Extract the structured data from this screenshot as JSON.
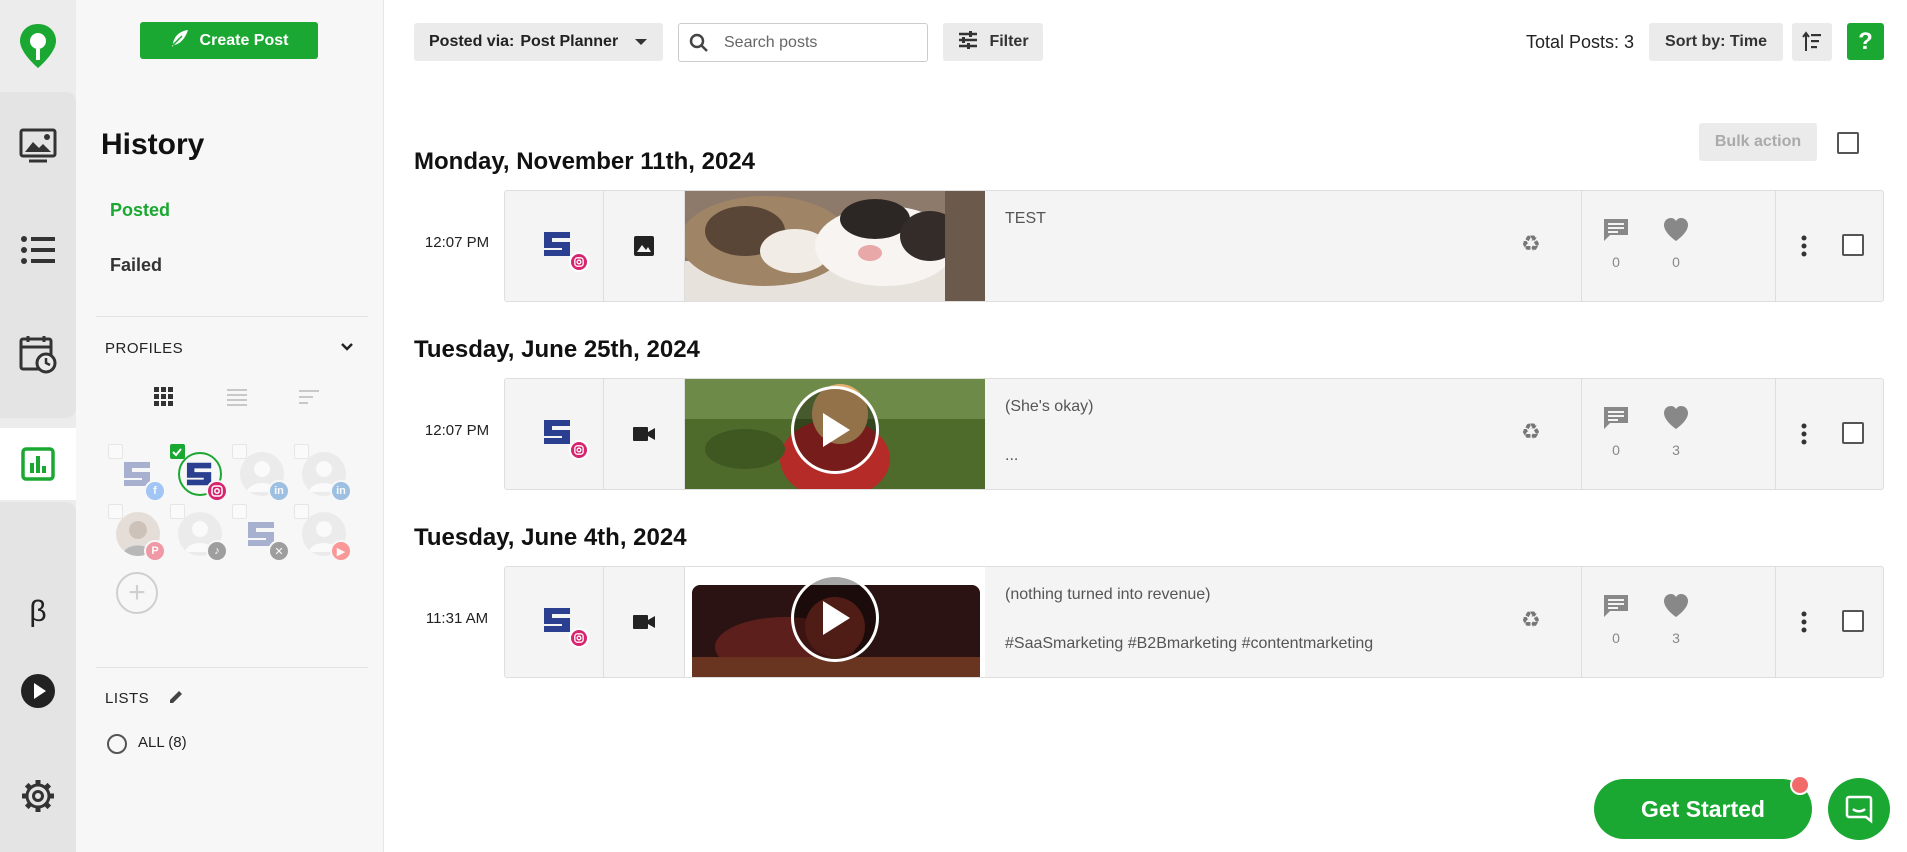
{
  "rail": {
    "items": [
      "logo-icon",
      "media-library-icon",
      "content-list-icon",
      "calendar-clock-icon",
      "analytics-icon",
      "beta-icon",
      "play-icon",
      "gear-icon"
    ],
    "beta_label": "β",
    "active": "analytics-icon"
  },
  "sidebar": {
    "create_post_label": "Create Post",
    "title": "History",
    "nav": {
      "posted": "Posted",
      "failed": "Failed"
    },
    "profiles_label": "PROFILES",
    "lists_label": "LISTS",
    "lists_all": "ALL (8)",
    "profiles": [
      {
        "network": "facebook",
        "selected": false
      },
      {
        "network": "instagram",
        "selected": true
      },
      {
        "network": "linkedin",
        "selected": false
      },
      {
        "network": "linkedin",
        "selected": false
      },
      {
        "network": "pinterest",
        "selected": false
      },
      {
        "network": "tiktok",
        "selected": false
      },
      {
        "network": "x",
        "selected": false
      },
      {
        "network": "youtube",
        "selected": false
      }
    ]
  },
  "toolbar": {
    "posted_via_label": "Posted via:",
    "posted_via_value": "Post Planner",
    "search_placeholder": "Search posts",
    "filter_label": "Filter",
    "total_posts": "Total Posts: 3",
    "sort_label": "Sort by: Time",
    "help_label": "?",
    "bulk_action_label": "Bulk action"
  },
  "groups": [
    {
      "date": "Monday, November 11th, 2024",
      "posts": [
        {
          "time": "12:07 PM",
          "media_type": "image",
          "text_line1": "TEST",
          "text_line2": "",
          "comments": "0",
          "likes": "0"
        }
      ]
    },
    {
      "date": "Tuesday, June 25th, 2024",
      "posts": [
        {
          "time": "12:07 PM",
          "media_type": "video",
          "text_line1": "(She's okay)",
          "text_line2": "...",
          "comments": "0",
          "likes": "3"
        }
      ]
    },
    {
      "date": "Tuesday, June 4th, 2024",
      "posts": [
        {
          "time": "11:31 AM",
          "media_type": "video",
          "text_line1": "(nothing turned into revenue)",
          "text_line2": "#SaaSmarketing #B2Bmarketing #contentmarketing",
          "comments": "0",
          "likes": "3"
        }
      ]
    }
  ],
  "cta": {
    "get_started_label": "Get Started"
  },
  "colors": {
    "brand": "#1aa832",
    "notification": "#f26b6b",
    "instagram": "#d6246e"
  }
}
